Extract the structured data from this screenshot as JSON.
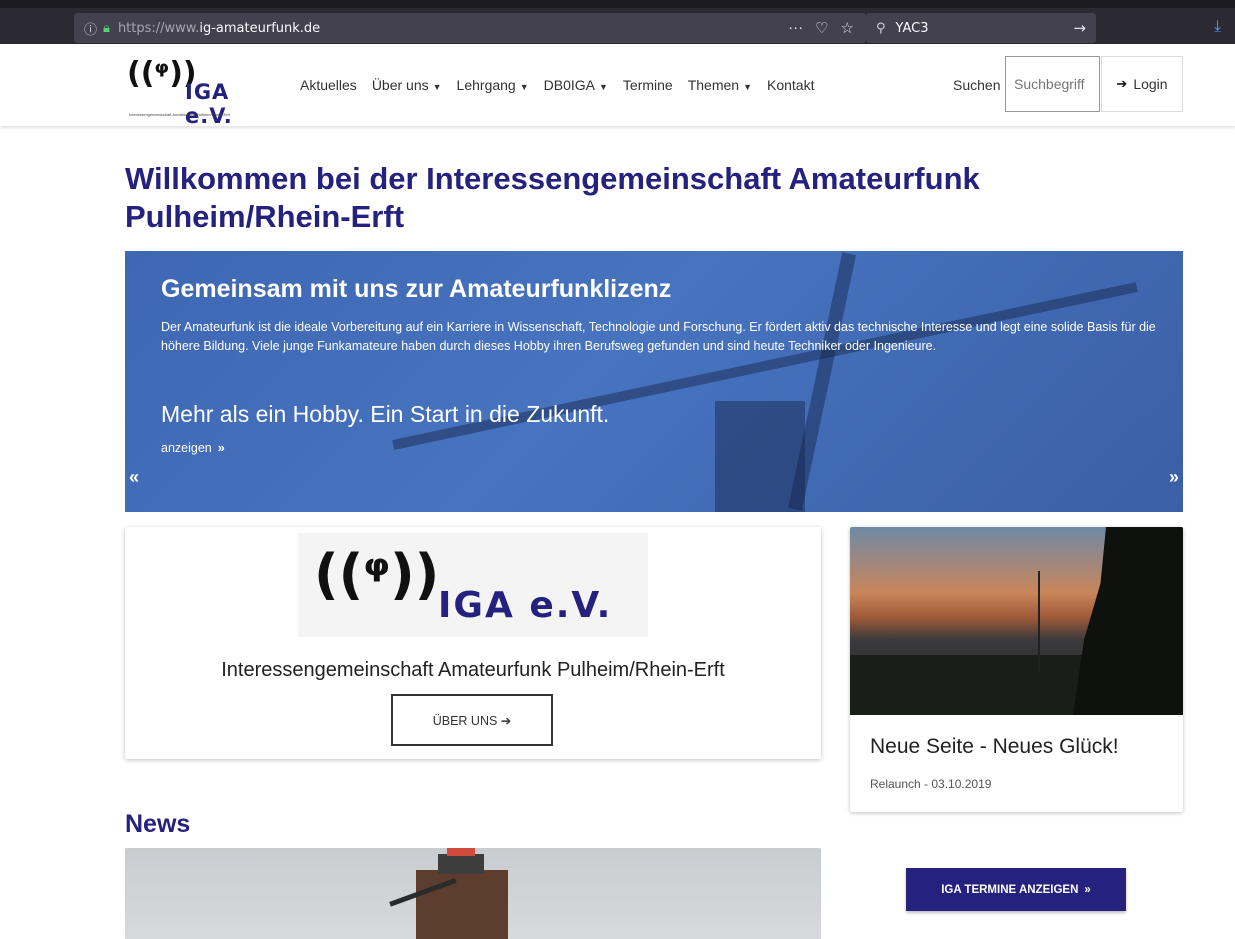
{
  "browser": {
    "url_protocol": "https://www.",
    "url_host": "ig-amateurfunk.de",
    "search_value": "YAC3",
    "icons": [
      "info-icon",
      "lock-icon",
      "more-icon",
      "pocket-icon",
      "star-icon",
      "search-icon",
      "go-arrow-icon",
      "download-icon"
    ]
  },
  "header": {
    "logo_brand": "IGA e.V.",
    "logo_tagline": "Interessengemeinschaft Amateurfunk Pulheim/Rhein-Erft",
    "nav": [
      {
        "label": "Aktuelles",
        "has_caret": false
      },
      {
        "label": "Über uns",
        "has_caret": true
      },
      {
        "label": "Lehrgang",
        "has_caret": true
      },
      {
        "label": "DB0IGA",
        "has_caret": true
      },
      {
        "label": "Termine",
        "has_caret": false
      },
      {
        "label": "Themen",
        "has_caret": true
      },
      {
        "label": "Kontakt",
        "has_caret": false
      }
    ],
    "search_label": "Suchen",
    "search_placeholder": "Suchbegriff",
    "login_label": "Login"
  },
  "page_title": "Willkommen bei der Interessengemeinschaft Amateurfunk Pulheim/Rhein-Erft",
  "hero": {
    "heading": "Gemeinsam mit uns zur Amateurfunklizenz",
    "lead": "Der Amateurfunk ist die ideale Vorbereitung auf ein Karriere in Wissenschaft, Technologie und Forschung. Er fördert aktiv das technische Interesse und legt eine solide Basis für die höhere Bildung. Viele junge Funkamateure haben durch dieses Hobby ihren Berufsweg gefunden und sind heute Techniker oder Ingenieure.",
    "slogan": "Mehr als ein Hobby. Ein Start in die Zukunft.",
    "more_label": "anzeigen",
    "prev": "«",
    "next": "»"
  },
  "card_left": {
    "logo_brand": "IGA e.V.",
    "org_name": "Interessengemeinschaft Amateurfunk Pulheim/Rhein-Erft",
    "button_label": "ÜBER UNS ➔"
  },
  "card_right": {
    "title": "Neue Seite - Neues Glück!",
    "meta": "Relaunch - 03.10.2019"
  },
  "news": {
    "heading": "News"
  },
  "termine_button": "IGA TERMINE ANZEIGEN",
  "colors": {
    "brand": "#25217e",
    "hero": "#4370bb"
  }
}
